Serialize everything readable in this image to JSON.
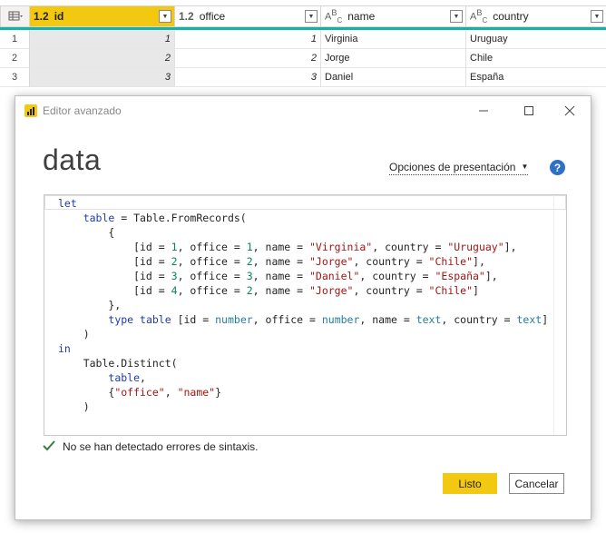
{
  "grid": {
    "columns": [
      {
        "type_icon": "1.2",
        "name": "id"
      },
      {
        "type_icon": "1.2",
        "name": "office"
      },
      {
        "type_icon": "ABC",
        "name": "name"
      },
      {
        "type_icon": "ABC",
        "name": "country"
      }
    ],
    "rows": [
      {
        "n": "1",
        "id": "1",
        "office": "1",
        "name": "Virginia",
        "country": "Uruguay"
      },
      {
        "n": "2",
        "id": "2",
        "office": "2",
        "name": "Jorge",
        "country": "Chile"
      },
      {
        "n": "3",
        "id": "3",
        "office": "3",
        "name": "Daniel",
        "country": "España"
      }
    ]
  },
  "dialog": {
    "title": "Editor avanzado",
    "query_name": "data",
    "display_options": "Opciones de presentación",
    "help": "?",
    "status": "No se han detectado errores de sintaxis.",
    "ok_label": "Listo",
    "cancel_label": "Cancelar"
  },
  "code": [
    "let",
    "    table = Table.FromRecords(",
    "        {",
    "            [id = 1, office = 1, name = \"Virginia\", country = \"Uruguay\"],",
    "            [id = 2, office = 2, name = \"Jorge\", country = \"Chile\"],",
    "            [id = 3, office = 3, name = \"Daniel\", country = \"España\"],",
    "            [id = 4, office = 2, name = \"Jorge\", country = \"Chile\"]",
    "        },",
    "        type table [id = number, office = number, name = text, country = text]",
    "    )",
    "in",
    "    Table.Distinct(",
    "        table,",
    "        {\"office\", \"name\"}",
    "    )"
  ],
  "colors": {
    "accent": "#f2c811",
    "header_underline": "#12b2a6",
    "keyword": "#1f3ca6",
    "string": "#a31515",
    "number": "#098658"
  }
}
